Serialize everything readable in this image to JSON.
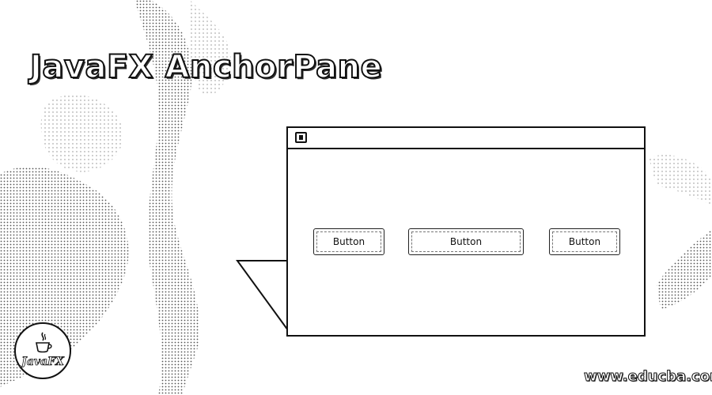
{
  "page": {
    "title": "JavaFX AnchorPane",
    "watermark": "www.educba.com"
  },
  "window": {
    "icon": "window-icon",
    "buttons": [
      {
        "label": "Button"
      },
      {
        "label": "Button"
      },
      {
        "label": "Button"
      }
    ]
  },
  "logo": {
    "icon": "java-cup-icon",
    "text": "JavaFX"
  },
  "colors": {
    "ink": "#111111",
    "background": "#ffffff"
  }
}
